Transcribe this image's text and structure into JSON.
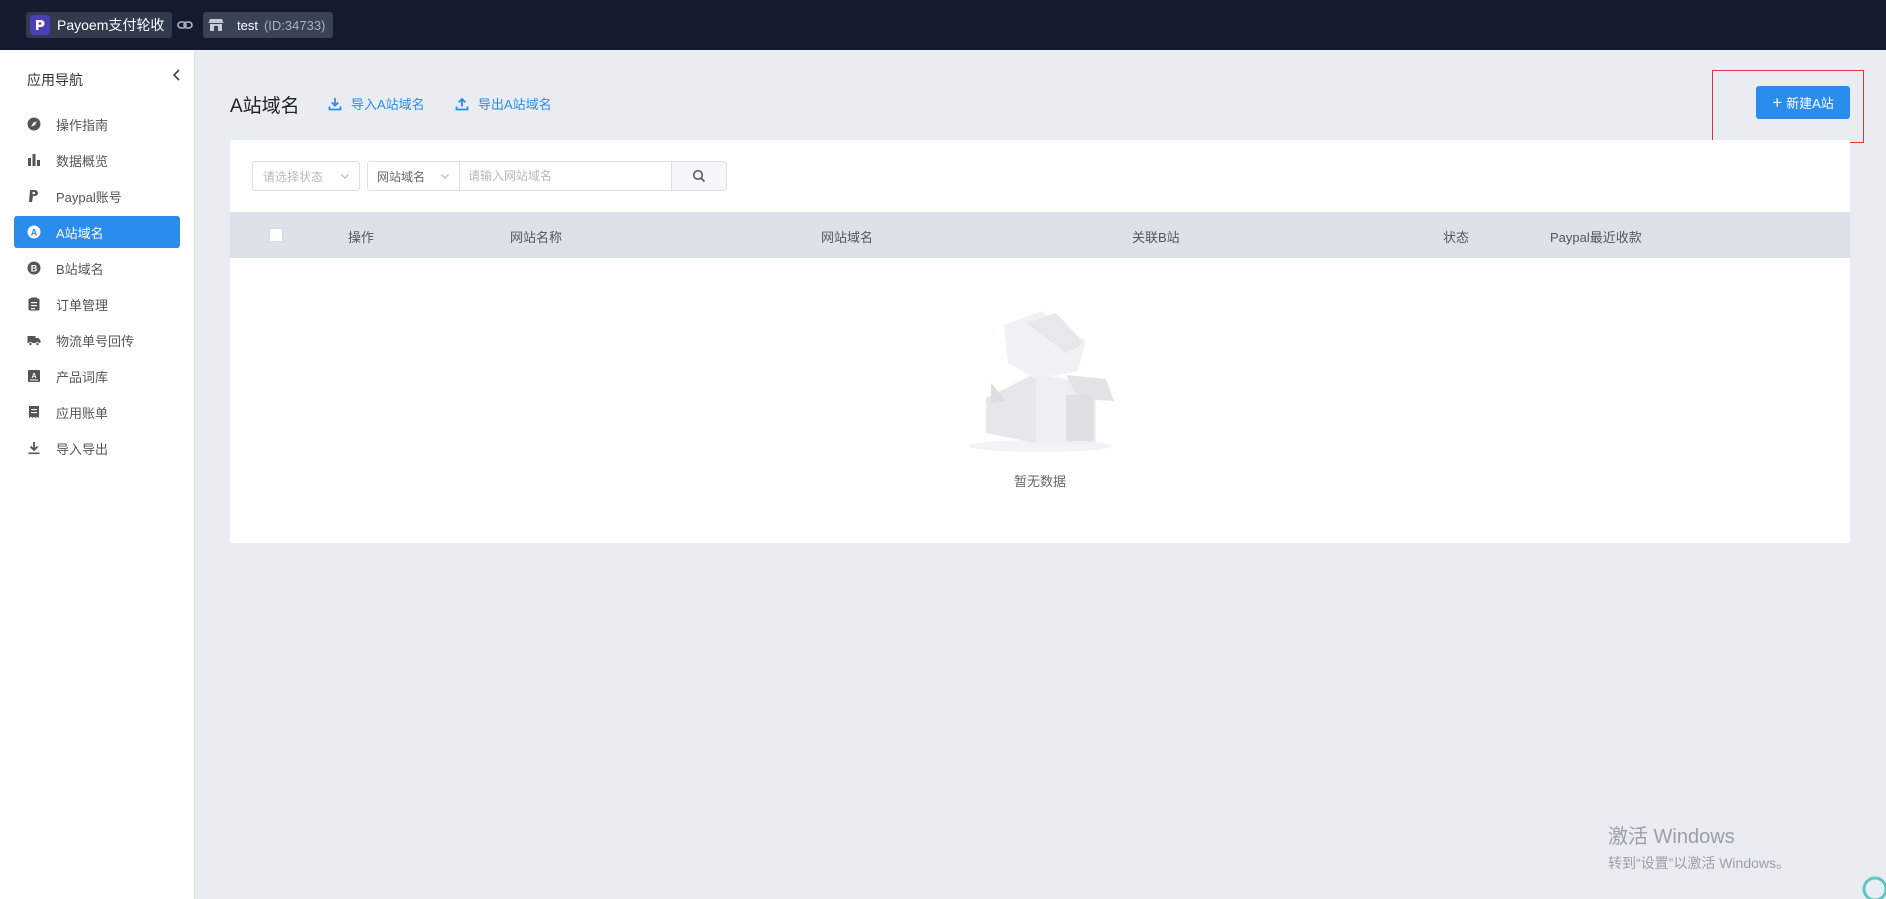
{
  "topbar": {
    "app_name": "Payoem支付轮收",
    "store_name": "test",
    "store_id": "(ID:34733)",
    "icons": [
      "payoem-logo-icon",
      "link-icon",
      "store-icon"
    ]
  },
  "sidebar": {
    "title": "应用导航",
    "items": [
      {
        "label": "操作指南",
        "icon": "compass-icon",
        "active": false
      },
      {
        "label": "数据概览",
        "icon": "bar-chart-icon",
        "active": false
      },
      {
        "label": "Paypal账号",
        "icon": "paypal-icon",
        "active": false
      },
      {
        "label": "A站域名",
        "icon": "letter-a-icon",
        "active": true
      },
      {
        "label": "B站域名",
        "icon": "letter-b-icon",
        "active": false
      },
      {
        "label": "订单管理",
        "icon": "clipboard-icon",
        "active": false
      },
      {
        "label": "物流单号回传",
        "icon": "truck-icon",
        "active": false
      },
      {
        "label": "产品词库",
        "icon": "dictionary-icon",
        "active": false
      },
      {
        "label": "应用账单",
        "icon": "bill-icon",
        "active": false
      },
      {
        "label": "导入导出",
        "icon": "download-icon",
        "active": false
      }
    ]
  },
  "main": {
    "title": "A站域名",
    "import_label": "导入A站域名",
    "export_label": "导出A站域名",
    "new_button": "新建A站"
  },
  "filters": {
    "status_placeholder": "请选择状态",
    "field_value": "网站域名",
    "search_placeholder": "请输入网站域名"
  },
  "table": {
    "columns": [
      "操作",
      "网站名称",
      "网站域名",
      "关联B站",
      "状态",
      "Paypal最近收款"
    ],
    "empty_text": "暂无数据"
  },
  "watermark": {
    "line1": "激活 Windows",
    "line2": "转到“设置”以激活 Windows。"
  },
  "colors": {
    "topbar": "#151b2e",
    "accent": "#2a8cec",
    "highlight": "#e03636"
  }
}
